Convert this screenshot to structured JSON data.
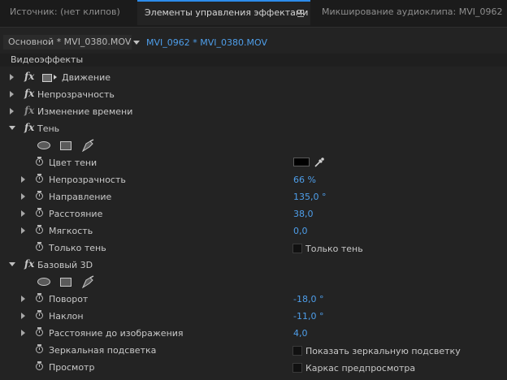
{
  "tabs": [
    {
      "label": "Источник: (нет клипов)",
      "active": false
    },
    {
      "label": "Элементы управления эффектами",
      "active": true
    },
    {
      "label": "Микширование аудиоклипа: MVI_0962",
      "active": false
    }
  ],
  "clipbar": {
    "master": "Основной * MVI_0380.MOV",
    "sequence": "MVI_0962 * MVI_0380.MOV"
  },
  "section_title": "Видеоэффекты",
  "effects": {
    "motion": "Движение",
    "opacity": "Непрозрачность",
    "time_remap": "Изменение времени",
    "shadow": {
      "name": "Тень",
      "shadow_color": "Цвет тени",
      "opacity": {
        "label": "Непрозрачность",
        "value": "66 %"
      },
      "direction": {
        "label": "Направление",
        "value": "135,0 °"
      },
      "distance": {
        "label": "Расстояние",
        "value": "38,0"
      },
      "softness": {
        "label": "Мягкость",
        "value": "0,0"
      },
      "shadow_only": {
        "label": "Только тень",
        "checkbox": "Только тень"
      }
    },
    "basic3d": {
      "name": "Базовый 3D",
      "swivel": {
        "label": "Поворот",
        "value": "-18,0 °"
      },
      "tilt": {
        "label": "Наклон",
        "value": "-11,0 °"
      },
      "distance": {
        "label": "Расстояние до изображения",
        "value": "4,0"
      },
      "specular": {
        "label": "Зеркальная подсветка",
        "checkbox": "Показать зеркальную подсветку"
      },
      "preview": {
        "label": "Просмотр",
        "checkbox": "Каркас предпросмотра"
      }
    }
  },
  "colors": {
    "accent": "#2d8ceb",
    "value_blue": "#4e9eea",
    "shadow_color": "#000000"
  }
}
